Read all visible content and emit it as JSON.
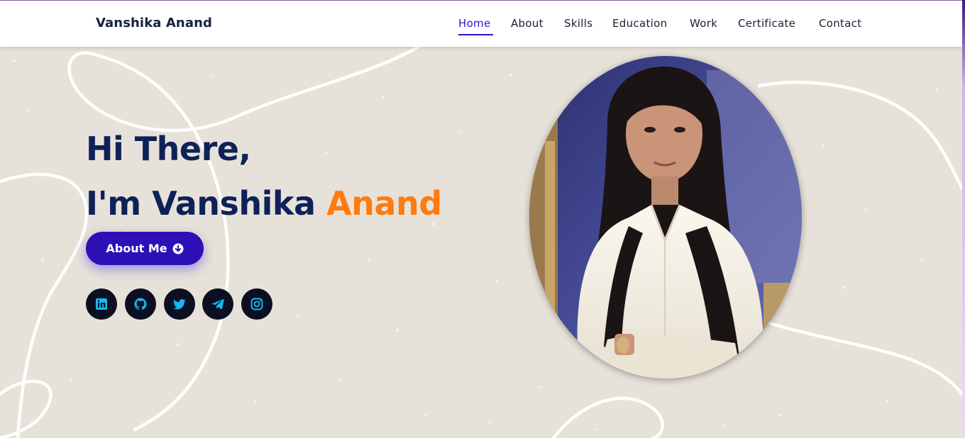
{
  "navbar": {
    "brand": "Vanshika Anand",
    "links": [
      {
        "label": "Home",
        "active": true
      },
      {
        "label": "About"
      },
      {
        "label": "Skills"
      },
      {
        "label": "Education"
      },
      {
        "label": "Work"
      },
      {
        "label": "Certificate"
      },
      {
        "label": "Contact"
      }
    ]
  },
  "hero": {
    "greeting": "Hi There,",
    "intro_prefix": "I'm Vanshika ",
    "intro_accent": "Anand",
    "about_button": {
      "label": "About Me",
      "icon": "arrow-circle-down-icon"
    },
    "socials": [
      {
        "icon": "linkedin-icon"
      },
      {
        "icon": "github-icon"
      },
      {
        "icon": "twitter-icon"
      },
      {
        "icon": "telegram-icon"
      },
      {
        "icon": "instagram-icon"
      }
    ]
  },
  "colors": {
    "background": "#e7e2d9",
    "navbar": "#ffffff",
    "heading": "#0e2158",
    "accent_orange": "#ff7b0f",
    "button": "#2d10b5",
    "nav_active": "#2a14c4",
    "social_bg": "#0c0f22",
    "social_icon": "#17b8f0"
  }
}
